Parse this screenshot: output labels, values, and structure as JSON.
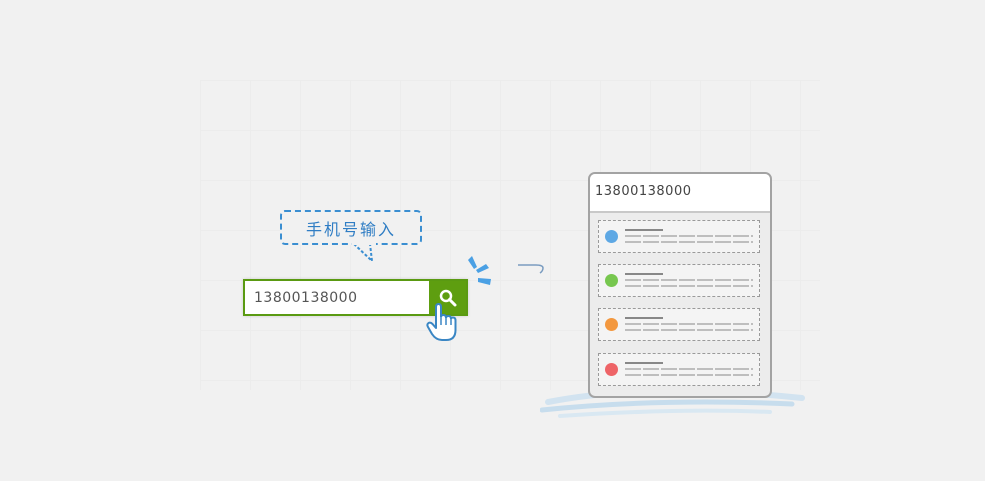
{
  "tooltip": {
    "label": "手机号输入"
  },
  "search": {
    "value": "13800138000",
    "button_icon": "search-icon"
  },
  "phone": {
    "query": "13800138000",
    "results": [
      {
        "color": "#5ea8e4"
      },
      {
        "color": "#77c74f"
      },
      {
        "color": "#f3983f"
      },
      {
        "color": "#ee6467"
      }
    ]
  },
  "colors": {
    "accent_green": "#5e9e10",
    "tooltip_blue": "#3a8ed1",
    "spark_blue": "#4aa0e4"
  }
}
